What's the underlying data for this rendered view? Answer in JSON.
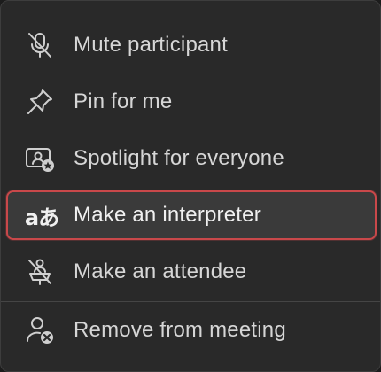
{
  "menu": {
    "items": [
      {
        "label": "Mute participant",
        "icon": "microphone-off-icon"
      },
      {
        "label": "Pin for me",
        "icon": "pin-icon"
      },
      {
        "label": "Spotlight for everyone",
        "icon": "spotlight-icon"
      },
      {
        "label": "Make an interpreter",
        "icon": "translate-icon",
        "glyph": "aあ",
        "highlighted": true
      },
      {
        "label": "Make an attendee",
        "icon": "presenter-off-icon"
      },
      {
        "label": "Remove from meeting",
        "icon": "person-remove-icon"
      }
    ],
    "highlight_color": "#c9484a"
  }
}
